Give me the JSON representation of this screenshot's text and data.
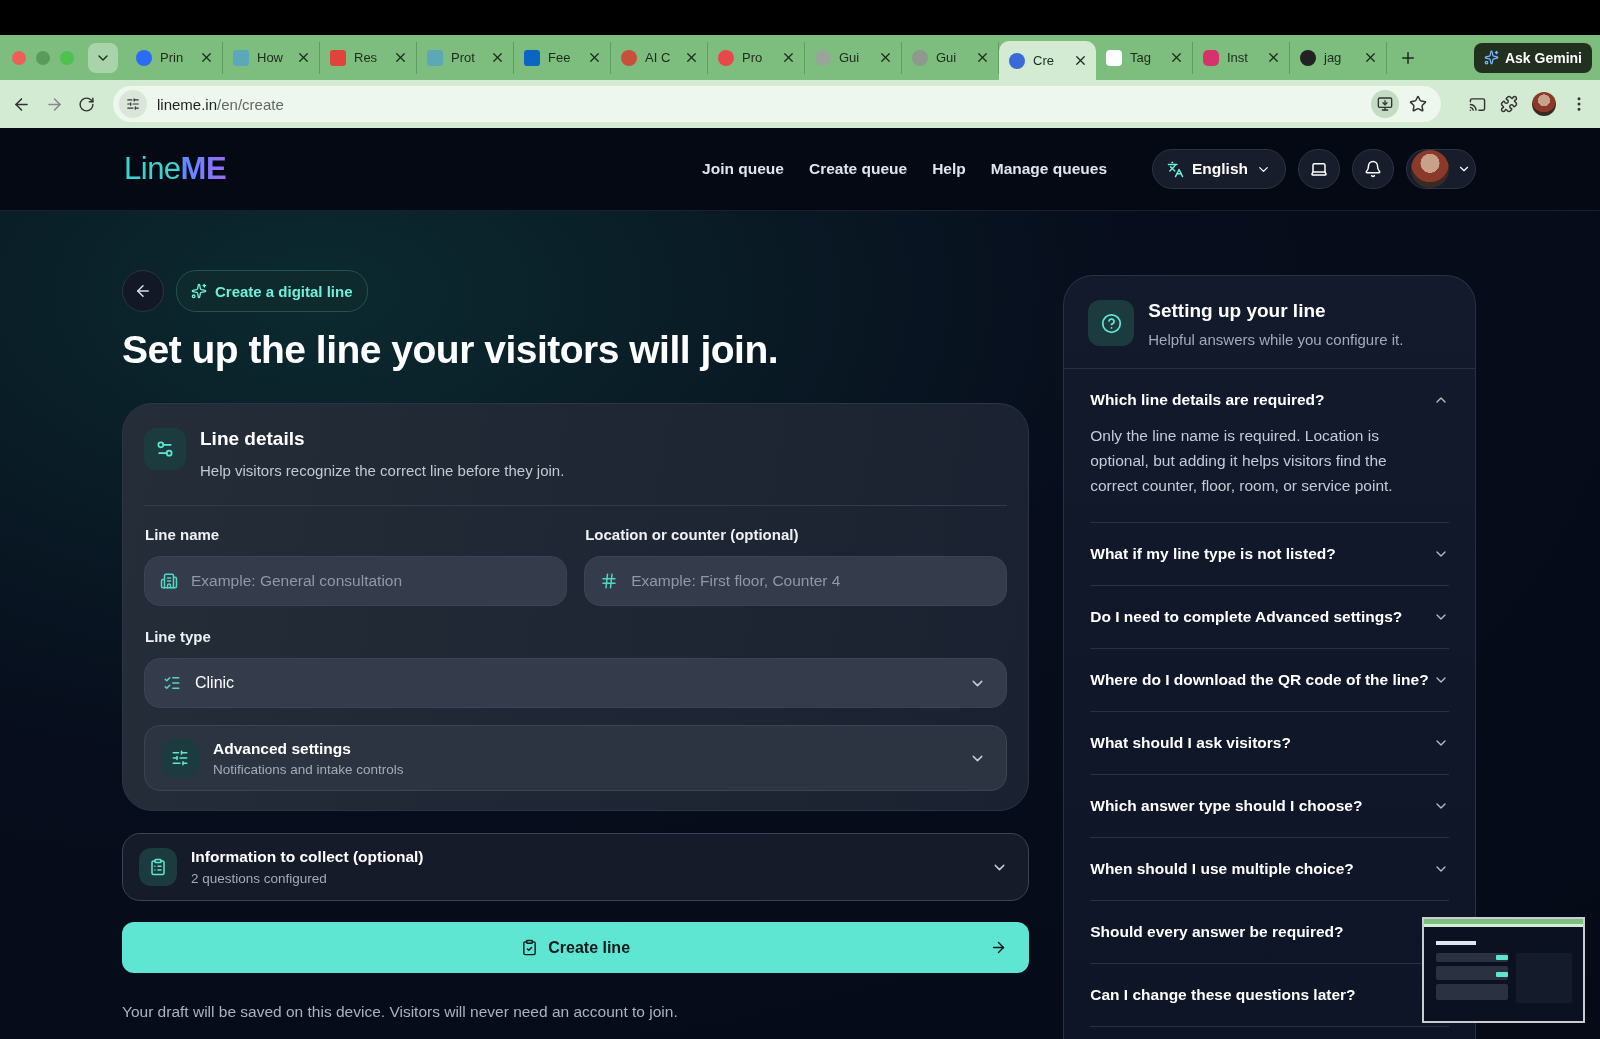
{
  "browser": {
    "tabs": [
      {
        "title": "Prin",
        "selected": false
      },
      {
        "title": "How",
        "selected": false
      },
      {
        "title": "Res",
        "selected": false
      },
      {
        "title": "Prot",
        "selected": false
      },
      {
        "title": "Fee",
        "selected": false
      },
      {
        "title": "AI C",
        "selected": false
      },
      {
        "title": "Pro",
        "selected": false
      },
      {
        "title": "Gui",
        "selected": false
      },
      {
        "title": "Gui",
        "selected": false
      },
      {
        "title": "Cre",
        "selected": true
      },
      {
        "title": "Tag",
        "selected": false
      },
      {
        "title": "Inst",
        "selected": false
      },
      {
        "title": "jag",
        "selected": false
      }
    ],
    "url_host": "lineme.in",
    "url_path": "/en/create",
    "ask_gemini": "Ask Gemini"
  },
  "nav": {
    "logo_light": "Line",
    "logo_bold": "ME",
    "links": [
      "Join queue",
      "Create queue",
      "Help",
      "Manage queues"
    ],
    "language": "English"
  },
  "page": {
    "badge": "Create a digital line",
    "heading": "Set up the line your visitors will join.",
    "line_details": {
      "title": "Line details",
      "subtitle": "Help visitors recognize the correct line before they join.",
      "fields": [
        {
          "label": "Line name",
          "placeholder": "Example: General consultation"
        },
        {
          "label": "Location or counter (optional)",
          "placeholder": "Example: First floor, Counter 4"
        }
      ],
      "line_type": {
        "label": "Line type",
        "value": "Clinic"
      },
      "advanced": {
        "title": "Advanced settings",
        "subtitle": "Notifications and intake controls",
        "expanded": false
      }
    },
    "collect": {
      "title": "Information to collect (optional)",
      "subtitle": "2 questions configured",
      "expanded": false
    },
    "create_button": "Create line",
    "note": "Your draft will be saved on this device. Visitors will never need an account to join."
  },
  "help": {
    "title": "Setting up your line",
    "subtitle": "Helpful answers while you configure it.",
    "faqs": [
      {
        "question": "Which line details are required?",
        "expanded": true,
        "answer": "Only the line name is required. Location is optional, but adding it helps visitors find the correct counter, floor, room, or service point."
      },
      {
        "question": "What if my line type is not listed?",
        "expanded": false
      },
      {
        "question": "Do I need to complete Advanced settings?",
        "expanded": false
      },
      {
        "question": "Where do I download the QR code of the line?",
        "expanded": false
      },
      {
        "question": "What should I ask visitors?",
        "expanded": false
      },
      {
        "question": "Which answer type should I choose?",
        "expanded": false
      },
      {
        "question": "When should I use multiple choice?",
        "expanded": false
      },
      {
        "question": "Should every answer be required?"
      },
      {
        "question": "Can I change these questions later?"
      }
    ]
  }
}
